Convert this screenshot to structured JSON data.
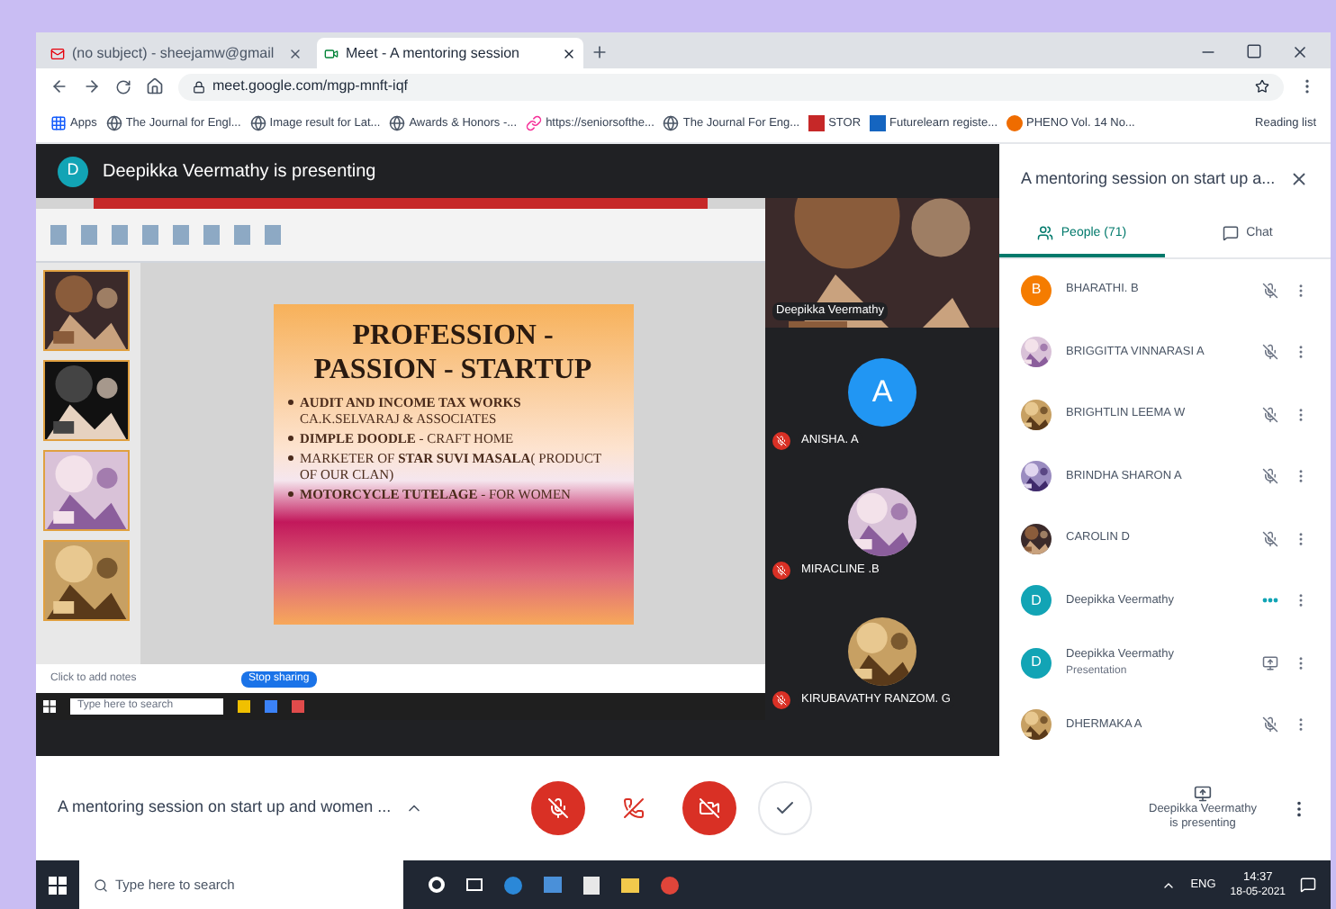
{
  "browser": {
    "tabs": [
      {
        "title": "(no subject) - sheejamw@gmail",
        "kind": "mail",
        "selected": false
      },
      {
        "title": "Meet - A mentoring session",
        "kind": "meet",
        "selected": true
      }
    ],
    "address": "meet.google.com/mgp-mnft-iqf",
    "bookmarks": [
      {
        "label": "Apps",
        "kind": "apps"
      },
      {
        "label": "The Journal for Engl...",
        "kind": "globe"
      },
      {
        "label": "Image result for Lat...",
        "kind": "globe"
      },
      {
        "label": "Awards & Honors -...",
        "kind": "globe"
      },
      {
        "label": "https://seniorsofthe...",
        "kind": "link"
      },
      {
        "label": "The Journal For Eng...",
        "kind": "globe"
      },
      {
        "label": "STOR",
        "kind": "red"
      },
      {
        "label": "Futurelearn registe...",
        "kind": "blue"
      },
      {
        "label": "PHENO Vol. 14 No...",
        "kind": "orange"
      }
    ],
    "reading_list": "Reading list"
  },
  "meet": {
    "banner": {
      "letter": "D",
      "text": "Deepikka Veermathy is presenting"
    },
    "shared_screen": {
      "slide": {
        "title_lines": [
          "PROFESSION -",
          "PASSION - STARTUP"
        ],
        "bullets": [
          "**AUDIT AND INCOME TAX WORKS** CA.K.SELVARAJ & ASSOCIATES",
          "**DIMPLE DOODLE** - CRAFT HOME",
          "MARKETER OF **STAR SUVI MASALA**( PRODUCT OF OUR CLAN)",
          "**MOTORCYCLE TUTELAGE** - FOR WOMEN"
        ]
      },
      "notes_placeholder": "Click to add notes",
      "share_button": "Stop sharing",
      "search": "Type here to search"
    },
    "tiles": [
      {
        "kind": "video",
        "name": "Deepikka Veermathy",
        "muted": false
      },
      {
        "kind": "letter",
        "letter": "A",
        "color": "#2196f3",
        "name": "ANISHA. A",
        "muted": true
      },
      {
        "kind": "picture",
        "name": "MIRACLINE .B",
        "muted": true
      },
      {
        "kind": "picture",
        "name": "KIRUBAVATHY RANZOM. G",
        "muted": true
      }
    ]
  },
  "panel": {
    "title": "A mentoring session on start up a...",
    "tabs": [
      {
        "label": "People (71)",
        "kind": "people",
        "selected": true
      },
      {
        "label": "Chat",
        "kind": "chat",
        "selected": false
      }
    ],
    "people": [
      {
        "name": "BHARATHI. B",
        "avatar": {
          "kind": "letter",
          "letter": "B",
          "color": "#f57c00"
        },
        "muted": true,
        "speaking": false,
        "presenting": false
      },
      {
        "name": "BRIGGITTA VINNARASI A",
        "muted": true,
        "speaking": false,
        "presenting": false
      },
      {
        "name": "BRIGHTLIN LEEMA W",
        "muted": true,
        "speaking": false,
        "presenting": false
      },
      {
        "name": "BRINDHA SHARON A",
        "muted": true,
        "speaking": false,
        "presenting": false
      },
      {
        "name": "CAROLIN D",
        "muted": true,
        "speaking": false,
        "presenting": false
      },
      {
        "name": "Deepikka Veermathy",
        "avatar": {
          "kind": "letter",
          "letter": "D",
          "color": "#12a4b5"
        },
        "muted": false,
        "speaking": true,
        "presenting": false
      },
      {
        "name": "Deepikka Veermathy",
        "sub": "Presentation",
        "avatar": {
          "kind": "letter",
          "letter": "D",
          "color": "#12a4b5"
        },
        "muted": false,
        "speaking": false,
        "presenting": true
      },
      {
        "name": "DHERMAKA A",
        "muted": true,
        "speaking": false,
        "presenting": false
      }
    ]
  },
  "controls": {
    "meeting_title": "A mentoring session on start up and women ...",
    "mic_on": false,
    "camera_on": false,
    "presenting_label": "Deepikka Veermathy is presenting"
  },
  "taskbar": {
    "search": "Type here to search",
    "time": "14:37",
    "date": "18-05-2021",
    "lang": "ENG"
  }
}
